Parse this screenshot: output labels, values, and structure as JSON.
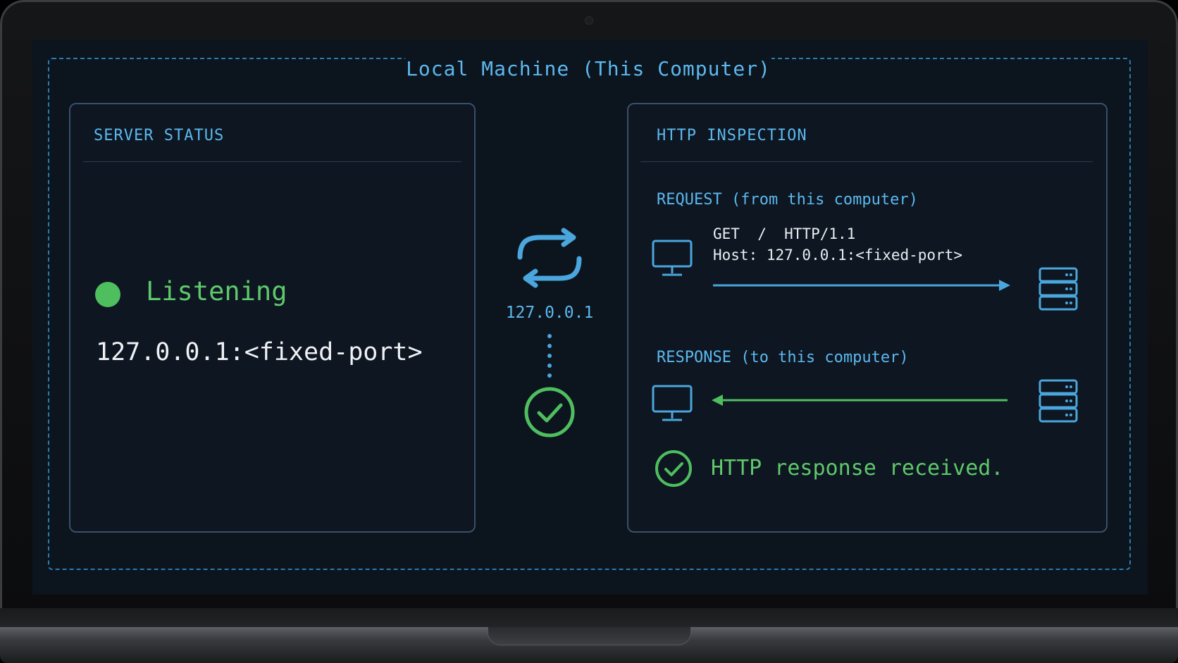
{
  "frame": {
    "title": "Local Machine (This Computer)"
  },
  "server_panel": {
    "heading": "SERVER STATUS",
    "status": "Listening",
    "address": "127.0.0.1:<fixed-port>"
  },
  "connector": {
    "ip": "127.0.0.1"
  },
  "http_panel": {
    "heading": "HTTP INSPECTION",
    "request": {
      "label": "REQUEST (from this computer)",
      "line1": "GET  /  HTTP/1.1",
      "line2": "Host: 127.0.0.1:<fixed-port>"
    },
    "response": {
      "label": "RESPONSE (to this computer)",
      "status": "HTTP response received."
    }
  },
  "icons": {
    "exchange": "swap-arrows-icon",
    "client": "monitor-icon",
    "server": "server-stack-icon",
    "ok": "check-circle-icon"
  },
  "colors": {
    "accent_blue": "#5cb8ee",
    "success_green": "#5fc86a",
    "background": "#0c141e"
  }
}
